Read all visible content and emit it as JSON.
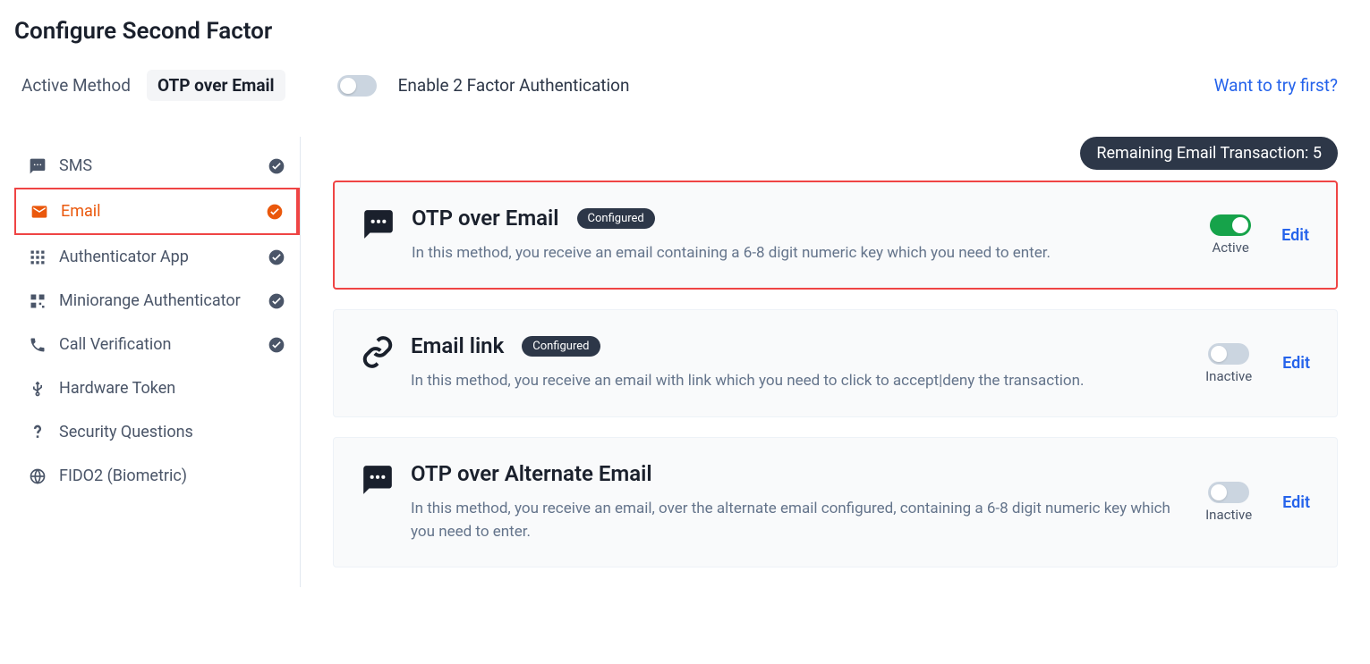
{
  "page_title": "Configure Second Factor",
  "header": {
    "active_method_label": "Active Method",
    "active_method_value": "OTP over Email",
    "enable_label": "Enable 2 Factor Authentication",
    "enable_state": false,
    "try_first": "Want to try first?"
  },
  "sidebar": {
    "items": [
      {
        "label": "SMS",
        "icon": "sms-icon",
        "checked": true,
        "active": false
      },
      {
        "label": "Email",
        "icon": "email-icon",
        "checked": true,
        "active": true
      },
      {
        "label": "Authenticator App",
        "icon": "grid-icon",
        "checked": true,
        "active": false
      },
      {
        "label": "Miniorange Authenticator",
        "icon": "qr-icon",
        "checked": true,
        "active": false
      },
      {
        "label": "Call Verification",
        "icon": "phone-icon",
        "checked": true,
        "active": false
      },
      {
        "label": "Hardware Token",
        "icon": "usb-icon",
        "checked": false,
        "active": false
      },
      {
        "label": "Security Questions",
        "icon": "question-icon",
        "checked": false,
        "active": false
      },
      {
        "label": "FIDO2 (Biometric)",
        "icon": "globe-icon",
        "checked": false,
        "active": false
      }
    ]
  },
  "remaining_badge": "Remaining Email Transaction: 5",
  "methods": [
    {
      "icon": "chat-icon",
      "title": "OTP over Email",
      "configured": "Configured",
      "description": "In this method, you receive an email containing a 6-8 digit numeric key which you need to enter.",
      "active": true,
      "state_label": "Active",
      "edit": "Edit",
      "highlighted": true
    },
    {
      "icon": "link-icon",
      "title": "Email link",
      "configured": "Configured",
      "description": "In this method, you receive an email with link which you need to click to accept|deny the transaction.",
      "active": false,
      "state_label": "Inactive",
      "edit": "Edit",
      "highlighted": false
    },
    {
      "icon": "chat-icon",
      "title": "OTP over Alternate Email",
      "configured": null,
      "description": "In this method, you receive an email, over the alternate email configured, containing a 6-8 digit numeric key which you need to enter.",
      "active": false,
      "state_label": "Inactive",
      "edit": "Edit",
      "highlighted": false
    }
  ],
  "colors": {
    "accent": "#ea580c",
    "highlight": "#ef4444",
    "link": "#2563eb",
    "badge_bg": "#2d3748",
    "toggle_on": "#16a34a"
  }
}
